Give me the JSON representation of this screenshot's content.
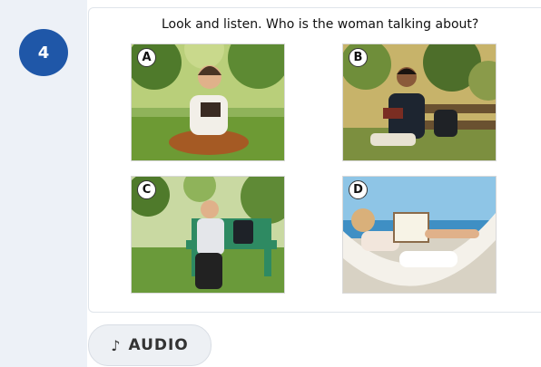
{
  "question": {
    "number": "4",
    "prompt": "Look and listen. Who is the woman talking about?"
  },
  "options": [
    {
      "label": "A",
      "icon": "photo-man-reading-on-grass"
    },
    {
      "label": "B",
      "icon": "photo-man-reading-on-bench"
    },
    {
      "label": "C",
      "icon": "photo-man-resting-on-bench"
    },
    {
      "label": "D",
      "icon": "photo-woman-reading-in-hammock"
    }
  ],
  "audio_button": {
    "icon": "music-note-icon",
    "note_glyph": "♪",
    "label": "AUDIO"
  },
  "colors": {
    "badge": "#1f57a8",
    "rail": "#edf1f7",
    "button_bg": "#edf0f4"
  }
}
